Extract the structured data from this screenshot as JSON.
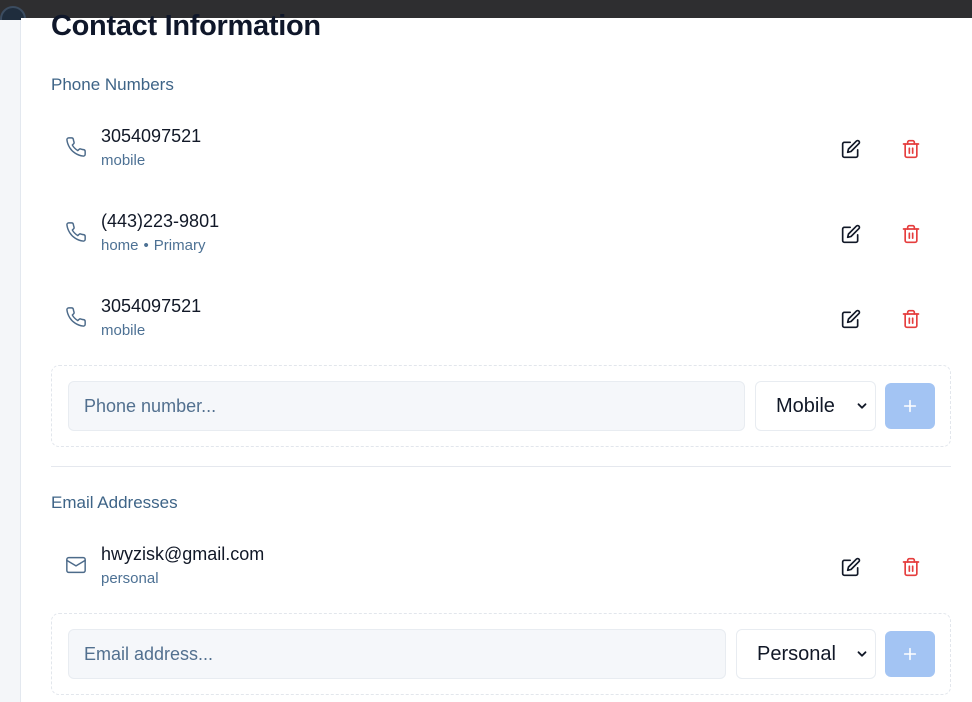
{
  "header": {
    "title": "Contact Information"
  },
  "phones": {
    "section_label": "Phone Numbers",
    "items": [
      {
        "number": "3054097521",
        "type": "mobile",
        "primary": ""
      },
      {
        "number": "(443)223-9801",
        "type": "home",
        "primary": "Primary"
      },
      {
        "number": "3054097521",
        "type": "mobile",
        "primary": ""
      }
    ],
    "add": {
      "placeholder": "Phone number...",
      "selected_type": "Mobile",
      "add_label": "+"
    }
  },
  "emails": {
    "section_label": "Email Addresses",
    "items": [
      {
        "address": "hwyzisk@gmail.com",
        "type": "personal"
      }
    ],
    "add": {
      "placeholder": "Email address...",
      "selected_type": "Personal",
      "add_label": "+"
    }
  },
  "icons": {
    "phone": "phone-icon",
    "email": "mail-icon",
    "edit": "edit-icon",
    "delete": "trash-icon",
    "add": "plus-icon",
    "dropdown": "chevron-down-icon"
  },
  "colors": {
    "accent_label": "#3e6487",
    "delete": "#e53e3e",
    "add_button": "#a3c4f3"
  },
  "separator": "•"
}
